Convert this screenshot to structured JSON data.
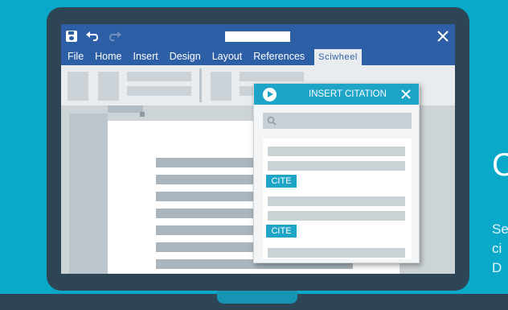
{
  "titlebar": {
    "save_icon": "save-icon",
    "undo_icon": "undo-icon",
    "redo_icon": "redo-icon",
    "close_icon": "close-icon"
  },
  "menu": {
    "items": [
      "File",
      "Home",
      "Insert",
      "Design",
      "Layout",
      "References"
    ],
    "active_tab": "Sciwheel"
  },
  "popup": {
    "title": "INSERT CITATION",
    "play_icon": "play-icon",
    "close_icon": "close-icon",
    "search_icon": "search-icon",
    "cite_labels": [
      "CITE",
      "CITE"
    ]
  },
  "right_panel": {
    "heading": "C",
    "lines": [
      "Se",
      "ci",
      "D"
    ]
  },
  "colors": {
    "background": "#0aa9c9",
    "laptop": "#2e4556",
    "ribbon_blue": "#2c5fa6",
    "accent": "#1ea4c6"
  }
}
